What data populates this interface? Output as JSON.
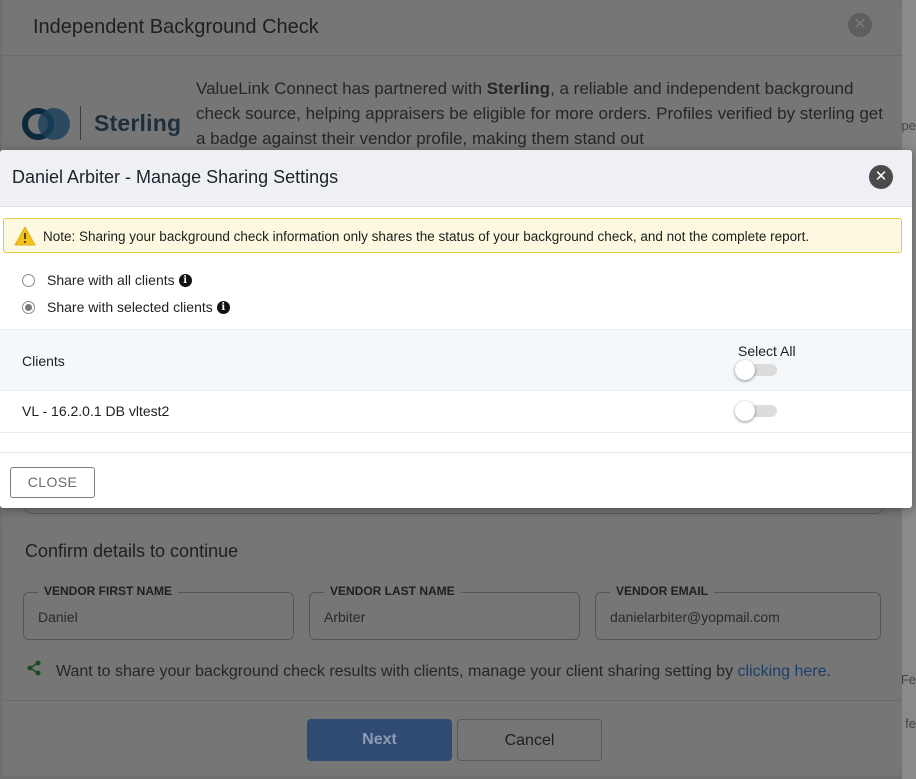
{
  "background_modal": {
    "title": "Independent Background Check",
    "logo_text": "Sterling",
    "intro_lead": "ValueLink Connect has partnered with ",
    "intro_brand": "Sterling",
    "intro_rest": ", a reliable and independent background check source, helping appraisers be eligible for more orders. Profiles verified by sterling get a badge against their vendor profile, making them stand out",
    "confirm_heading": "Confirm details to continue",
    "fields": [
      {
        "label": "VENDOR FIRST NAME",
        "value": "Daniel"
      },
      {
        "label": "VENDOR LAST NAME",
        "value": "Arbiter"
      },
      {
        "label": "VENDOR EMAIL",
        "value": "danielarbiter@yopmail.com"
      }
    ],
    "share_text": "Want to share your background check results with clients, manage your client sharing setting by ",
    "share_link": "clicking here",
    "share_end": ".",
    "next_label": "Next",
    "cancel_label": "Cancel",
    "edge_texts": [
      "pe",
      "Fe",
      "fe"
    ]
  },
  "dialog": {
    "title": "Daniel Arbiter - Manage Sharing Settings",
    "note": "Note: Sharing your background check information only shares the status of your background check, and not the complete report.",
    "radio_all": "Share with all clients",
    "radio_selected": "Share with selected clients",
    "selected_option": "selected",
    "table": {
      "col_clients": "Clients",
      "col_select_all": "Select All",
      "select_all_on": false,
      "rows": [
        {
          "client": "VL - 16.2.0.1 DB vltest2",
          "shared": false
        }
      ]
    },
    "close_label": "CLOSE"
  },
  "colors": {
    "note_bg": "#fdf9e1",
    "note_border": "#e3c842",
    "warning_icon": "#f2c21b",
    "header_bg": "#eef0f5"
  }
}
